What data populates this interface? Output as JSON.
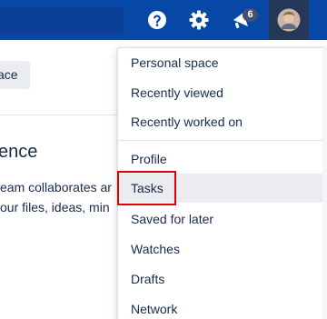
{
  "header": {
    "notification_count": "6",
    "icons": [
      "help-icon",
      "gear-icon",
      "megaphone-icon",
      "avatar"
    ],
    "colors": {
      "bar": "#0747a6",
      "avatar_bg": "#253858"
    }
  },
  "background": {
    "space_chip": "ace",
    "heading": "ence",
    "line1": "eam collaborates ar",
    "line2": "our files, ideas, min"
  },
  "menu": {
    "groups": [
      [
        "Personal space",
        "Recently viewed",
        "Recently worked on"
      ],
      [
        "Profile",
        "Tasks",
        "Saved for later",
        "Watches",
        "Drafts",
        "Network"
      ]
    ],
    "highlighted": "Tasks",
    "highlight_color": "#e00000"
  }
}
